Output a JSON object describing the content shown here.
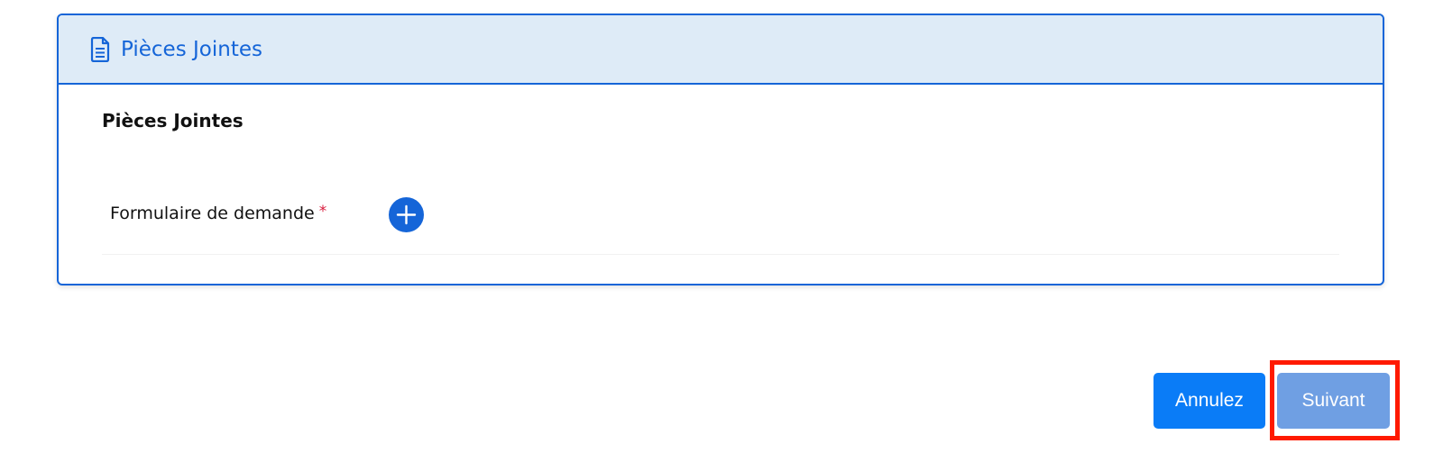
{
  "panel": {
    "header_title": "Pièces Jointes",
    "header_icon": "document-icon",
    "accent_color": "#1565d8",
    "header_bg": "#deebf7"
  },
  "section": {
    "title": "Pièces Jointes"
  },
  "fields": [
    {
      "label": "Formulaire de demande",
      "required_marker": "*",
      "add_icon": "plus-circle-icon"
    }
  ],
  "actions": {
    "cancel_label": "Annulez",
    "next_label": "Suivant",
    "cancel_color": "#0a7cf7",
    "next_color": "#6f9fe3",
    "highlight_color": "#ff1a00"
  }
}
